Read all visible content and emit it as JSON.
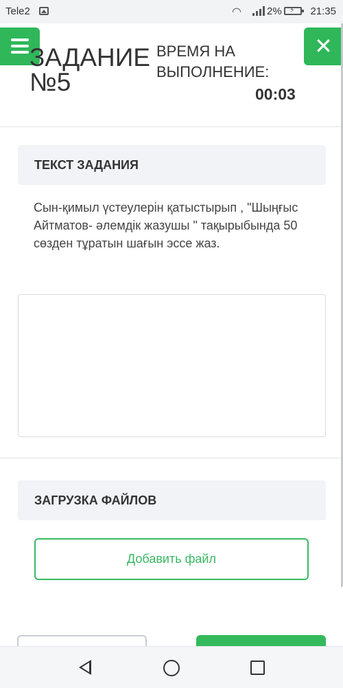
{
  "status_bar": {
    "carrier": "Tele2",
    "battery_percent": "2%",
    "time": "21:35",
    "icons": [
      "image-icon",
      "wifi-icon",
      "signal-icon",
      "battery-charging-icon"
    ]
  },
  "header": {
    "title": "ЗАДАНИЕ №5",
    "timer_label": "ВРЕМЯ НА ВЫПОЛНЕНИЕ:",
    "timer_value": "00:03",
    "menu_icon": "hamburger-icon",
    "close_icon": "close-icon",
    "accent_color": "#2fb75a"
  },
  "task": {
    "heading": "ТЕКСТ ЗАДАНИЯ",
    "text": "Сын-қимыл үстеулерін қатыстырып , \"Шыңғыс Айтматов- әлемдік жазушы \" тақырыбында 50 сөзден тұратын шағын эссе жаз.",
    "answer_value": ""
  },
  "upload": {
    "heading": "ЗАГРУЗКА ФАЙЛОВ",
    "add_file_label": "Добавить файл"
  },
  "nav": {
    "icons": [
      "back-icon",
      "home-icon",
      "recent-apps-icon"
    ]
  }
}
